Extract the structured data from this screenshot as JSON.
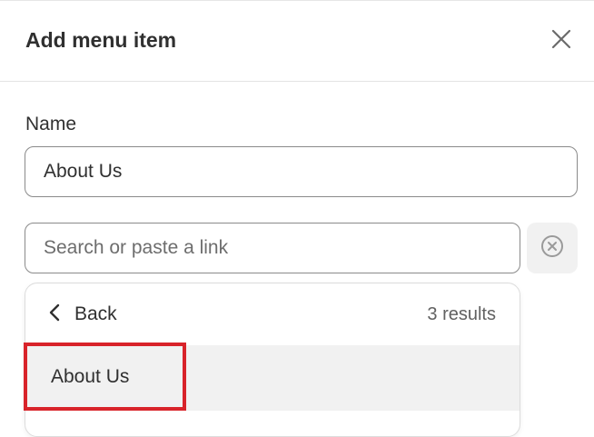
{
  "dialog": {
    "title": "Add menu item",
    "close_icon": "close-icon"
  },
  "form": {
    "name_label": "Name",
    "name_value": "About Us",
    "search_placeholder": "Search or paste a link",
    "search_value": "",
    "clear_icon": "circle-x-icon"
  },
  "dropdown": {
    "back_label": "Back",
    "back_icon": "chevron-left-icon",
    "results_count": "3 results",
    "items": [
      {
        "label": "About Us"
      }
    ]
  },
  "colors": {
    "highlight_border": "#d8232a",
    "item_hover_bg": "#f1f1f1",
    "input_border": "#8a8a8a"
  }
}
